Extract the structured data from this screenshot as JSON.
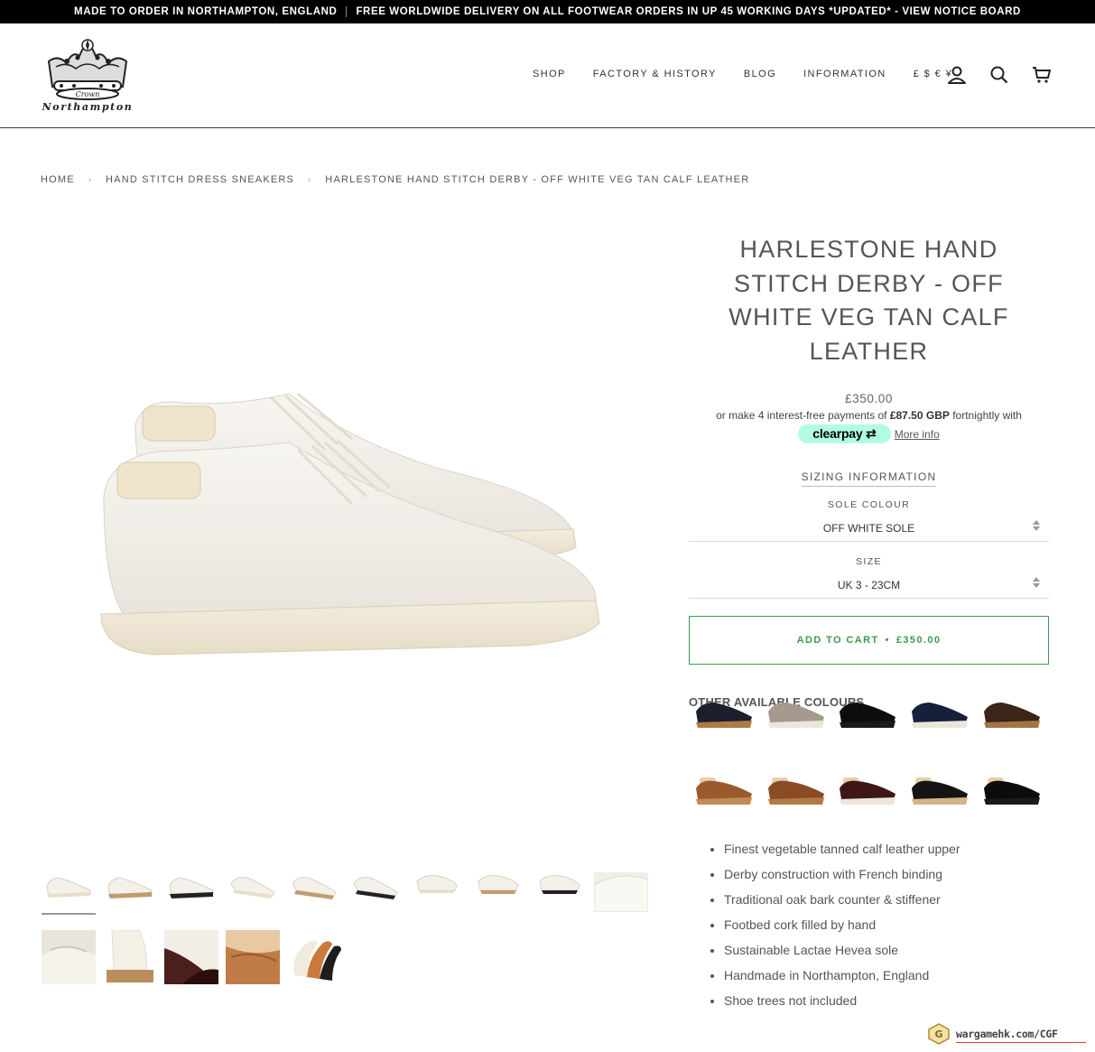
{
  "announcement": {
    "left": "MADE TO ORDER IN NORTHAMPTON, ENGLAND",
    "right": "FREE WORLDWIDE DELIVERY ON ALL FOOTWEAR ORDERS IN UP 45 WORKING DAYS *UPDATED* - VIEW NOTICE BOARD"
  },
  "brand": {
    "logo_text": "Northampton",
    "crown_text": "Crown"
  },
  "nav": {
    "items": [
      "SHOP",
      "FACTORY & HISTORY",
      "BLOG",
      "INFORMATION"
    ],
    "currency": "£ $ € ¥"
  },
  "breadcrumb": [
    "HOME",
    "HAND STITCH DRESS SNEAKERS",
    "HARLESTONE HAND STITCH DERBY - OFF WHITE VEG TAN CALF LEATHER"
  ],
  "product": {
    "title": "HARLESTONE HAND STITCH DERBY - OFF WHITE VEG TAN CALF LEATHER",
    "price": "£350.00",
    "clearpay_prefix": "or make 4 interest-free payments of",
    "clearpay_amount": "£87.50 GBP",
    "clearpay_suffix": "fortnightly with",
    "clearpay_brand": "clearpay",
    "more_info": "More info",
    "sizing_info": "SIZING INFORMATION",
    "sole_colour_label": "SOLE COLOUR",
    "sole_colour_value": "OFF WHITE SOLE",
    "size_label": "SIZE",
    "size_value": "UK 3 - 23CM",
    "add_to_cart": "ADD TO CART",
    "add_to_cart_price": "£350.00",
    "other_colours_label": "OTHER AVAILABLE COLOURS",
    "features": [
      "Finest vegetable tanned calf leather upper",
      "Derby construction with French binding",
      "Traditional oak bark counter & stiffener",
      "Footbed cork filled by hand",
      "Sustainable Lactae Hevea sole",
      "Handmade in Northampton, England",
      "Shoe trees not included"
    ]
  },
  "watermark": "wargamehk.com/CGF",
  "colors": {
    "cart_green": "#3c9a52",
    "clearpay_mint": "#b2fce4",
    "announcement_bg": "#000000"
  }
}
